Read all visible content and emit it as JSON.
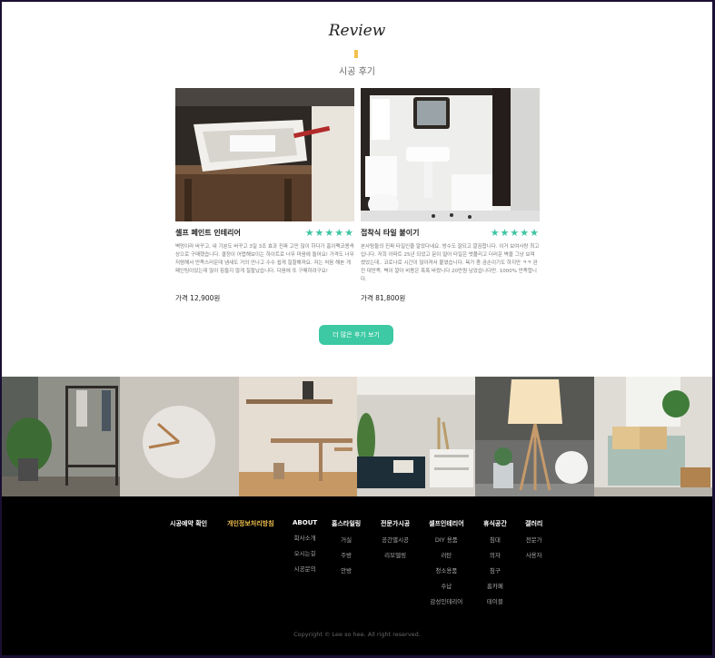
{
  "review": {
    "title": "Review",
    "subtitle": "시공 후기"
  },
  "cards": [
    {
      "title": "셀프 페인트 인테리어",
      "stars": "★★★★★",
      "body": "벽멍이라 바꾸고, 내 기분도 바꾸고 3일 3조 효과 진짜 고민 많이 하다가 홈이펙코용색상으로 구매했습니다. 결정이 어렵해보이는 하이트로 너무 마음에 들어요! 가격도 너무 저렴해서 만족스러운데 냄새도 거의 안나고 수수 쉽게 칠할해져요. 저는 처음 해본 게 페인팅이었는데 많이 힘들지 않게 칠할났습니다. 다음에 또 구매하려구요!",
      "price": "가격 12,900원"
    },
    {
      "title": "접착식 타일 붙이기",
      "stars": "★★★★★",
      "body": "본사탐들의 진짜 타일인줄 알았다네요. 방수도 잘되고 깔끔합니다. 이거 보여사랑 최고입니다. 저희 아파트 25년 되었고 문이 얼어 타일은 벗풀리고 더러운 벽을 그냥 보며 썼었는데.. 코로나로 시간이 많아져서 붙였습니다. 욕가 좀 곰손이기도 하지만 ㅋㅋ 완전 대만족. 벽이 깔아 비용은 폭폭 바랐니다 20만원 남았습니다만. 1000% 만족합니다.",
      "price": "가격 81,800원"
    }
  ],
  "more_button": "더 많은 후기 보기",
  "footer": {
    "columns": [
      {
        "head": "시공예약 확인",
        "items": []
      },
      {
        "head": "개인정보처리방침",
        "items": [],
        "highlight": true
      },
      {
        "head": "ABOUT",
        "items": [
          "회사소개",
          "오시는길",
          "시공문의"
        ]
      },
      {
        "head": "홈스타일링",
        "items": [
          "거실",
          "주방",
          "안방"
        ]
      },
      {
        "head": "전문가시공",
        "items": [
          "공간별시공",
          "리모델링"
        ]
      },
      {
        "head": "셀프인테리어",
        "items": [
          "DIY 용품",
          "러탄",
          "청소용품",
          "수납",
          "감성인테리어"
        ]
      },
      {
        "head": "휴식공간",
        "items": [
          "침대",
          "의자",
          "침구",
          "홈카페",
          "테이블"
        ]
      },
      {
        "head": "갤러리",
        "items": [
          "전문가",
          "사용자"
        ]
      }
    ],
    "copyright": "Copyright © Lee so hee. All right reserved."
  },
  "colors": {
    "accent": "#3cc9a3",
    "star": "#3ec4a3",
    "highlight": "#f2c14e"
  }
}
